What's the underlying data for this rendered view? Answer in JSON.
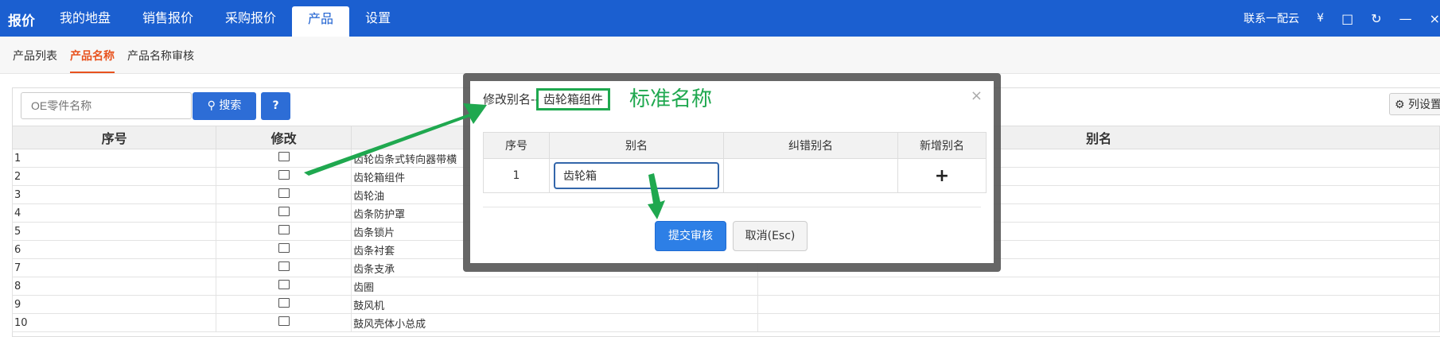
{
  "header": {
    "brand": "报价",
    "nav": [
      {
        "label": "我的地盘"
      },
      {
        "label": "销售报价"
      },
      {
        "label": "采购报价"
      },
      {
        "label": "产品"
      },
      {
        "label": "设置"
      }
    ],
    "contact": "联系一配云",
    "currency": "¥",
    "accent": "#1b5fd0"
  },
  "subnav": {
    "items": [
      {
        "label": "产品列表"
      },
      {
        "label": "产品名称"
      },
      {
        "label": "产品名称审核"
      }
    ],
    "active_color": "#e8531f"
  },
  "search": {
    "placeholder": "OE零件名称",
    "button_label": "搜索",
    "help_label": "?",
    "column_settings": "列设置"
  },
  "table": {
    "headers": [
      "序号",
      "修改",
      "",
      "别名"
    ],
    "rows": [
      {
        "no": "1",
        "name": "齿轮齿条式转向器带横"
      },
      {
        "no": "2",
        "name": "齿轮箱组件"
      },
      {
        "no": "3",
        "name": "齿轮油"
      },
      {
        "no": "4",
        "name": "齿条防护罩"
      },
      {
        "no": "5",
        "name": "齿条锁片"
      },
      {
        "no": "6",
        "name": "齿条衬套"
      },
      {
        "no": "7",
        "name": "齿条支承"
      },
      {
        "no": "8",
        "name": "齿圈"
      },
      {
        "no": "9",
        "name": "鼓风机"
      },
      {
        "no": "10",
        "name": "鼓风壳体小总成"
      }
    ]
  },
  "modal": {
    "title_prefix": "修改别名--",
    "title_name": "齿轮箱组件",
    "annotation": "标准名称",
    "columns": [
      "序号",
      "别名",
      "纠错别名",
      "新增别名"
    ],
    "row": {
      "no": "1",
      "alias": "齿轮箱",
      "correction": ""
    },
    "add_symbol": "+",
    "submit_label": "提交审核",
    "cancel_label": "取消(Esc)",
    "close_symbol": "×",
    "annotation_color": "#1fa84f"
  }
}
